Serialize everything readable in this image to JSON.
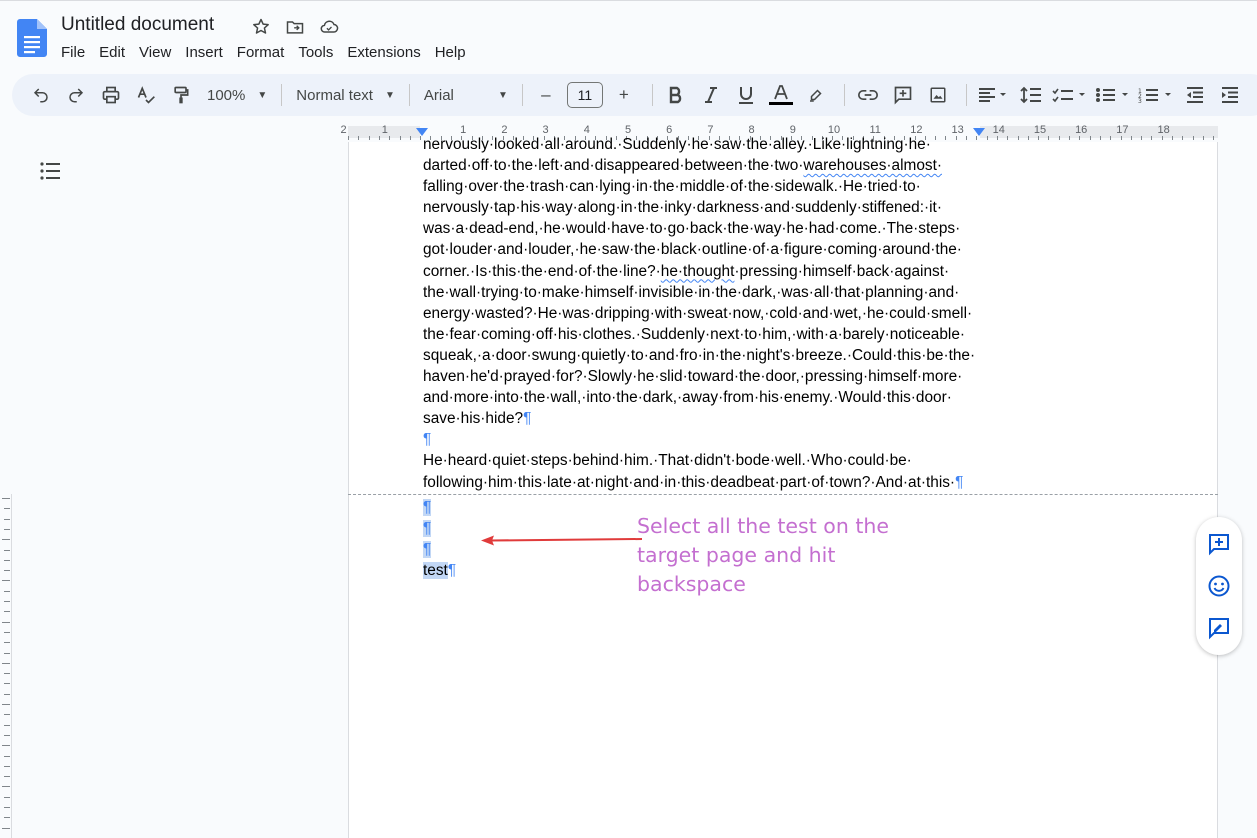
{
  "header": {
    "title": "Untitled document",
    "menu": [
      "File",
      "Edit",
      "View",
      "Insert",
      "Format",
      "Tools",
      "Extensions",
      "Help"
    ]
  },
  "toolbar": {
    "zoom": "100%",
    "style": "Normal text",
    "font": "Arial",
    "font_size": "11",
    "minus": "–",
    "plus": "+"
  },
  "ruler": {
    "numbers": [
      "2",
      "1",
      "1",
      "2",
      "3",
      "4",
      "5",
      "6",
      "7",
      "8",
      "9",
      "10",
      "11",
      "12",
      "13",
      "14",
      "15",
      "16",
      "17",
      "18"
    ]
  },
  "document": {
    "page1_lines": [
      "nervously·looked·all·around.·Suddenly·he·saw·the·alley.·Like·lightning·he·",
      "darted·off·to·the·left·and·disappeared·between·the·two·",
      "falling·over·the·trash·can·lying·in·the·middle·of·the·sidewalk.·He·tried·to·",
      "nervously·tap·his·way·along·in·the·inky·darkness·and·suddenly·stiffened:·it·",
      "was·a·dead-end,·he·would·have·to·go·back·the·way·he·had·come.·The·steps·",
      "got·louder·and·louder,·he·saw·the·black·outline·of·a·figure·coming·around·the·",
      "corner.·Is·this·the·end·of·the·line?·",
      "the·wall·trying·to·make·himself·invisible·in·the·dark,·was·all·that·planning·and·",
      "energy·wasted?·He·was·dripping·with·sweat·now,·cold·and·wet,·he·could·smell·",
      "the·fear·coming·off·his·clothes.·Suddenly·next·to·him,·with·a·barely·noticeable·",
      "squeak,·a·door·swung·quietly·to·and·fro·in·the·night's·breeze.·Could·this·be·the·",
      "haven·he'd·prayed·for?·Slowly·he·slid·toward·the·door,·pressing·himself·more·",
      "and·more·into·the·wall,·into·the·dark,·away·from·his·enemy.·Would·this·door·",
      "save·his·hide?"
    ],
    "line2_squiggle": "warehouses·almost·",
    "line7_squiggle": "he·thought",
    "line7_rest": "·pressing·himself·back·against·",
    "para2_lines": [
      "He·heard·quiet·steps·behind·him.·That·didn't·bode·well.·Who·could·be·",
      "following·him·this·late·at·night·and·in·this·deadbeat·part·of·town?·And·at·this·"
    ],
    "pilcrow": "¶",
    "page2_text": "test"
  },
  "annotation": {
    "text": "Select all the test on the target page and hit backspace",
    "color": "#c46fd0",
    "arrow_color": "#e03b3b"
  },
  "colors": {
    "accent": "#4285f4",
    "selection": "#c2d7f5",
    "toolbar_bg": "#edf2fa"
  }
}
